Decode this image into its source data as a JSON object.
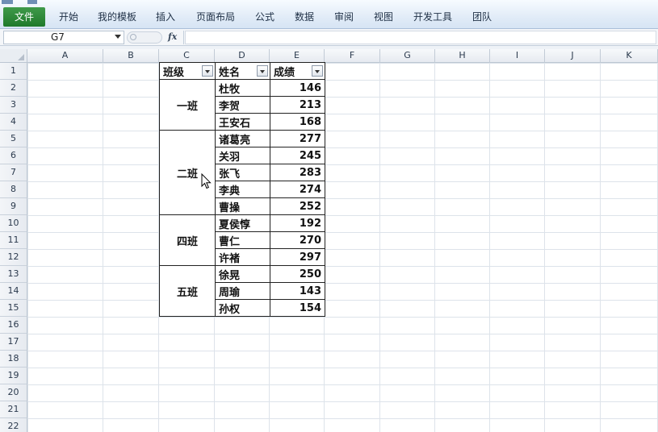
{
  "ribbon": {
    "file_tab": "文件",
    "tabs": [
      "开始",
      "我的模板",
      "插入",
      "页面布局",
      "公式",
      "数据",
      "审阅",
      "视图",
      "开发工具",
      "团队"
    ]
  },
  "formula_bar": {
    "name_box": "G7",
    "fx_label": "fx",
    "formula": ""
  },
  "columns": [
    "A",
    "B",
    "C",
    "D",
    "E",
    "F",
    "G",
    "H",
    "I",
    "J",
    "K"
  ],
  "rows": [
    "1",
    "2",
    "3",
    "4",
    "5",
    "6",
    "7",
    "8",
    "9",
    "10",
    "11",
    "12",
    "13",
    "14",
    "15",
    "16",
    "17",
    "18",
    "19",
    "20",
    "21",
    "22"
  ],
  "table": {
    "headers": [
      "班级",
      "姓名",
      "成绩"
    ],
    "groups": [
      {
        "class": "一班",
        "rows": [
          {
            "name": "杜牧",
            "score": "146"
          },
          {
            "name": "李贺",
            "score": "213"
          },
          {
            "name": "王安石",
            "score": "168"
          }
        ]
      },
      {
        "class": "二班",
        "rows": [
          {
            "name": "诸葛亮",
            "score": "277"
          },
          {
            "name": "关羽",
            "score": "245"
          },
          {
            "name": "张飞",
            "score": "283"
          },
          {
            "name": "李典",
            "score": "274"
          },
          {
            "name": "曹操",
            "score": "252"
          }
        ]
      },
      {
        "class": "四班",
        "rows": [
          {
            "name": "夏侯惇",
            "score": "192"
          },
          {
            "name": "曹仁",
            "score": "270"
          },
          {
            "name": "许褚",
            "score": "297"
          }
        ]
      },
      {
        "class": "五班",
        "rows": [
          {
            "name": "徐晃",
            "score": "250"
          },
          {
            "name": "周瑜",
            "score": "143"
          },
          {
            "name": "孙权",
            "score": "154"
          }
        ]
      }
    ]
  },
  "colors": {
    "file_tab": "#1f7a2b",
    "grid_line": "#dde3ea",
    "header_bg": "#e6eaf0"
  }
}
